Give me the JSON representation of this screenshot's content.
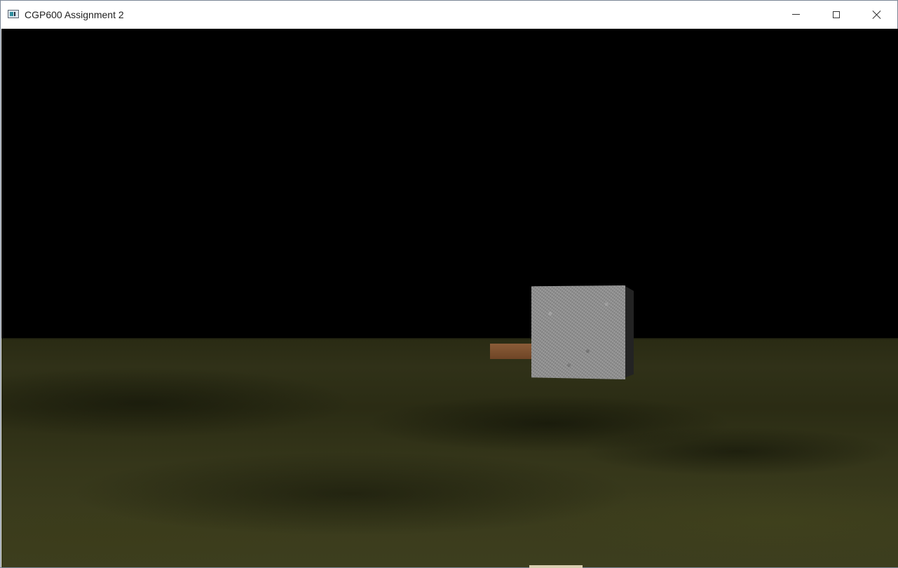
{
  "window": {
    "title": "CGP600 Assignment 2",
    "controls": {
      "minimize": "minimize",
      "maximize": "maximize",
      "close": "close"
    }
  },
  "scene": {
    "sky_color": "#000000",
    "ground_color": "#34351a",
    "objects": [
      {
        "name": "stone-cube",
        "material": "granite",
        "color": "#8f8f8f"
      },
      {
        "name": "wooden-plank",
        "material": "wood",
        "color": "#7d5030"
      }
    ]
  }
}
